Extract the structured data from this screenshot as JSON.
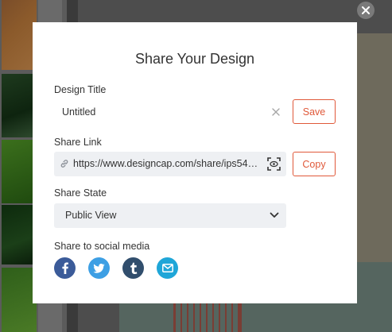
{
  "modal": {
    "title": "Share Your Design",
    "design_title": {
      "label": "Design Title",
      "value": "Untitled",
      "save_label": "Save"
    },
    "share_link": {
      "label": "Share Link",
      "url": "https://www.designcap.com/share/ips547...",
      "copy_label": "Copy"
    },
    "share_state": {
      "label": "Share State",
      "selected": "Public View"
    },
    "social": {
      "label": "Share to social media",
      "networks": [
        "facebook",
        "twitter",
        "tumblr",
        "email"
      ],
      "colors": {
        "facebook": "#3b5b99",
        "twitter": "#3d9fe4",
        "tumblr": "#314e6d",
        "email": "#1fa6d8"
      }
    }
  },
  "colors": {
    "accent": "#e0593a",
    "field_bg": "#eef0f3",
    "overlay": "#3a3a3a"
  },
  "icons": {
    "close": "close-icon",
    "clear": "clear-icon",
    "link": "link-icon",
    "qr": "qr-scan-icon",
    "chevron": "chevron-down-icon"
  }
}
